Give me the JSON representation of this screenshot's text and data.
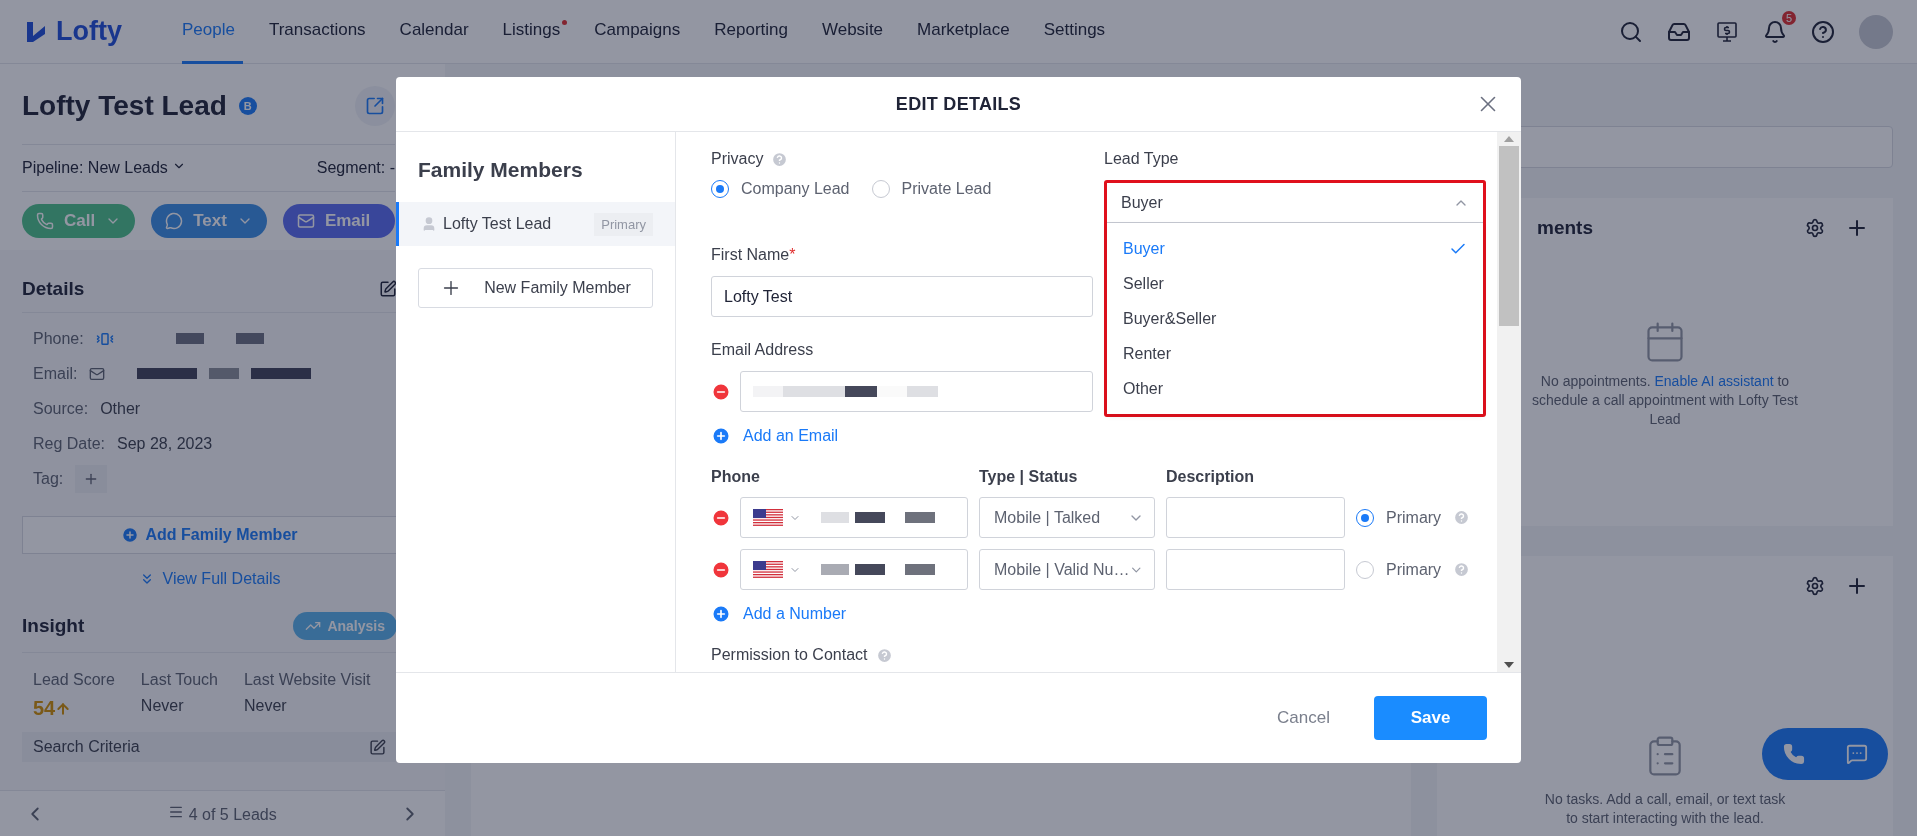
{
  "nav": {
    "logo": "Lofty",
    "items": [
      {
        "label": "People",
        "selected": true,
        "dot": false
      },
      {
        "label": "Transactions",
        "selected": false,
        "dot": false
      },
      {
        "label": "Calendar",
        "selected": false,
        "dot": false
      },
      {
        "label": "Listings",
        "selected": false,
        "dot": true
      },
      {
        "label": "Campaigns",
        "selected": false,
        "dot": false
      },
      {
        "label": "Reporting",
        "selected": false,
        "dot": false
      },
      {
        "label": "Website",
        "selected": false,
        "dot": false
      },
      {
        "label": "Marketplace",
        "selected": false,
        "dot": false
      },
      {
        "label": "Settings",
        "selected": false,
        "dot": false
      }
    ],
    "notification_count": "5"
  },
  "lead": {
    "name": "Lofty Test Lead",
    "badge": "B",
    "pipeline": "Pipeline: New Leads",
    "segment": "Segment: -",
    "actions": [
      {
        "kind": "call",
        "label": "Call"
      },
      {
        "kind": "text",
        "label": "Text"
      },
      {
        "kind": "email",
        "label": "Email"
      }
    ]
  },
  "details": {
    "title": "Details",
    "fields": [
      {
        "kind": "phone",
        "label": "Phone:"
      },
      {
        "kind": "email",
        "label": "Email:"
      },
      {
        "kind": "text",
        "label": "Source:",
        "value": "Other"
      },
      {
        "kind": "text",
        "label": "Reg Date:",
        "value": "Sep 28, 2023"
      },
      {
        "kind": "tag",
        "label": "Tag:"
      }
    ],
    "add_family": "Add Family Member",
    "view_full": "View Full Details"
  },
  "insight": {
    "title": "Insight",
    "analysis": "Analysis",
    "stats": [
      {
        "kind": "score",
        "label": "Lead Score",
        "value": "54"
      },
      {
        "kind": "text",
        "label": "Last Touch",
        "value": "Never"
      },
      {
        "kind": "text",
        "label": "Last Website Visit",
        "value": "Never"
      }
    ],
    "search_criteria": "Search Criteria"
  },
  "pager": "4 of 5 Leads",
  "appointments": {
    "title": "ments",
    "text_before": "No appointments.",
    "link": "Enable AI assistant",
    "text_after": "to schedule a call appointment with Lofty Test Lead"
  },
  "tasks": {
    "text": "No tasks. Add a call, email, or text task to start interacting with the lead."
  },
  "modal": {
    "title": "EDIT DETAILS",
    "family": {
      "title": "Family Members",
      "members": [
        {
          "name": "Lofty Test Lead",
          "tag": "Primary",
          "selected": true
        }
      ],
      "add_button": "New Family Member"
    },
    "privacy": {
      "label": "Privacy",
      "options": [
        {
          "label": "Company Lead",
          "selected": true
        },
        {
          "label": "Private Lead",
          "selected": false
        }
      ]
    },
    "lead_type": {
      "label": "Lead Type",
      "value": "Buyer",
      "open": true,
      "highlighted": true,
      "options": [
        {
          "label": "Buyer",
          "selected": true
        },
        {
          "label": "Seller",
          "selected": false
        },
        {
          "label": "Buyer&Seller",
          "selected": false
        },
        {
          "label": "Renter",
          "selected": false
        },
        {
          "label": "Other",
          "selected": false
        }
      ]
    },
    "first_name": {
      "label": "First Name",
      "required_mark": "*",
      "value": "Lofty Test"
    },
    "email": {
      "label": "Email Address",
      "add_label": "Add an Email"
    },
    "phone": {
      "columns": [
        "Phone",
        "Type | Status",
        "Description"
      ],
      "rows": [
        {
          "status": "Mobile | Talked",
          "primary": true,
          "primary_label": "Primary"
        },
        {
          "status": "Mobile | Valid Nu…",
          "primary": false,
          "primary_label": "Primary"
        }
      ],
      "add_label": "Add a Number"
    },
    "permission": {
      "label": "Permission to Contact"
    },
    "buttons": {
      "cancel": "Cancel",
      "save": "Save"
    }
  }
}
